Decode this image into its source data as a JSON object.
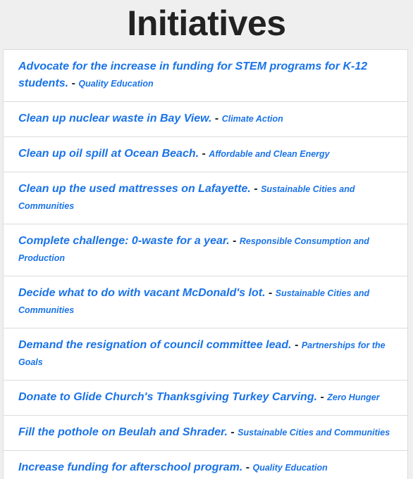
{
  "page": {
    "title": "Initiatives"
  },
  "separator": " - ",
  "initiatives": [
    {
      "title": "Advocate for the increase in funding for STEM programs for K-12 students.",
      "goal": "Quality Education"
    },
    {
      "title": "Clean up nuclear waste in Bay View.",
      "goal": "Climate Action"
    },
    {
      "title": "Clean up oil spill at Ocean Beach.",
      "goal": "Affordable and Clean Energy"
    },
    {
      "title": "Clean up the used mattresses on Lafayette.",
      "goal": "Sustainable Cities and Communities"
    },
    {
      "title": "Complete challenge: 0-waste for a year.",
      "goal": "Responsible Consumption and Production"
    },
    {
      "title": "Decide what to do with vacant McDonald's lot.",
      "goal": "Sustainable Cities and Communities"
    },
    {
      "title": "Demand the resignation of council committee lead.",
      "goal": "Partnerships for the Goals"
    },
    {
      "title": "Donate to Glide Church's Thanksgiving Turkey Carving.",
      "goal": "Zero Hunger"
    },
    {
      "title": "Fill the pothole on Beulah and Shrader.",
      "goal": "Sustainable Cities and Communities"
    },
    {
      "title": "Increase funding for afterschool program.",
      "goal": "Quality Education"
    }
  ]
}
